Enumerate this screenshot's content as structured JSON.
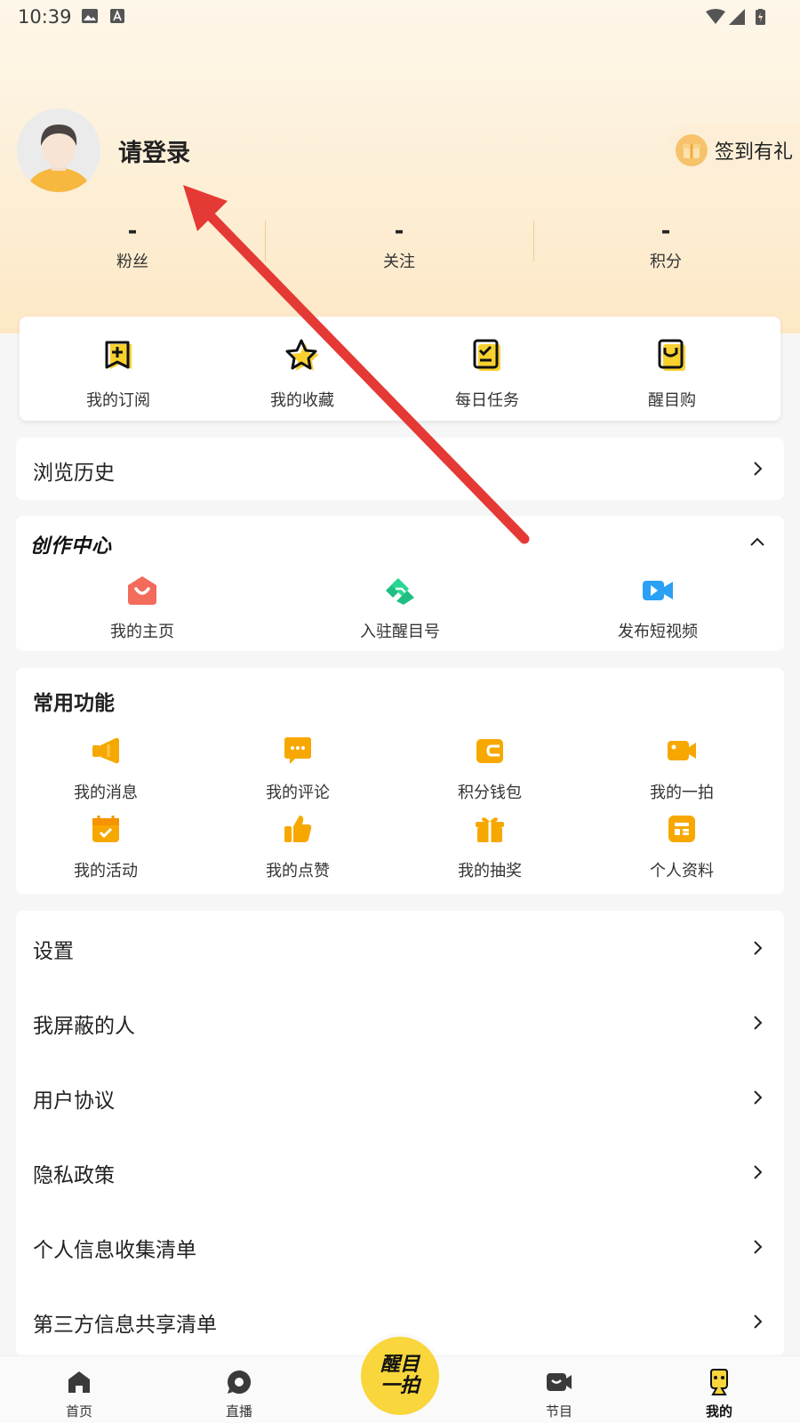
{
  "status_bar": {
    "time": "10:39"
  },
  "profile": {
    "login_text": "请登录",
    "checkin_label": "签到有礼"
  },
  "stats": [
    {
      "value": "-",
      "label": "粉丝"
    },
    {
      "value": "-",
      "label": "关注"
    },
    {
      "value": "-",
      "label": "积分"
    }
  ],
  "quick_actions": [
    {
      "label": "我的订阅",
      "icon": "subscription-icon"
    },
    {
      "label": "我的收藏",
      "icon": "star-icon"
    },
    {
      "label": "每日任务",
      "icon": "task-icon"
    },
    {
      "label": "醒目购",
      "icon": "shopping-bag-icon"
    }
  ],
  "history": {
    "label": "浏览历史"
  },
  "creation_center": {
    "title": "创作中心",
    "items": [
      {
        "label": "我的主页",
        "icon": "home-page-icon"
      },
      {
        "label": "入驻醒目号",
        "icon": "handshake-icon"
      },
      {
        "label": "发布短视频",
        "icon": "video-camera-icon"
      }
    ]
  },
  "common_functions": {
    "title": "常用功能",
    "items": [
      {
        "label": "我的消息",
        "icon": "megaphone-icon"
      },
      {
        "label": "我的评论",
        "icon": "comment-icon"
      },
      {
        "label": "积分钱包",
        "icon": "wallet-icon"
      },
      {
        "label": "我的一拍",
        "icon": "camera-icon"
      },
      {
        "label": "我的活动",
        "icon": "calendar-icon"
      },
      {
        "label": "我的点赞",
        "icon": "thumbs-up-icon"
      },
      {
        "label": "我的抽奖",
        "icon": "gift-icon"
      },
      {
        "label": "个人资料",
        "icon": "profile-card-icon"
      }
    ]
  },
  "settings": [
    {
      "label": "设置"
    },
    {
      "label": "我屏蔽的人"
    },
    {
      "label": "用户协议"
    },
    {
      "label": "隐私政策"
    },
    {
      "label": "个人信息收集清单"
    },
    {
      "label": "第三方信息共享清单"
    }
  ],
  "bottom_nav": {
    "items": [
      {
        "label": "首页",
        "icon": "home-icon"
      },
      {
        "label": "直播",
        "icon": "live-icon"
      },
      {
        "label": "节目",
        "icon": "program-icon"
      },
      {
        "label": "我的",
        "icon": "mine-icon"
      }
    ],
    "center_logo": {
      "line1": "醒目",
      "line2": "一拍"
    },
    "active": "我的"
  },
  "colors": {
    "accent": "#f7a800",
    "arrow": "#e53935",
    "logo_yellow": "#f8d63c"
  }
}
